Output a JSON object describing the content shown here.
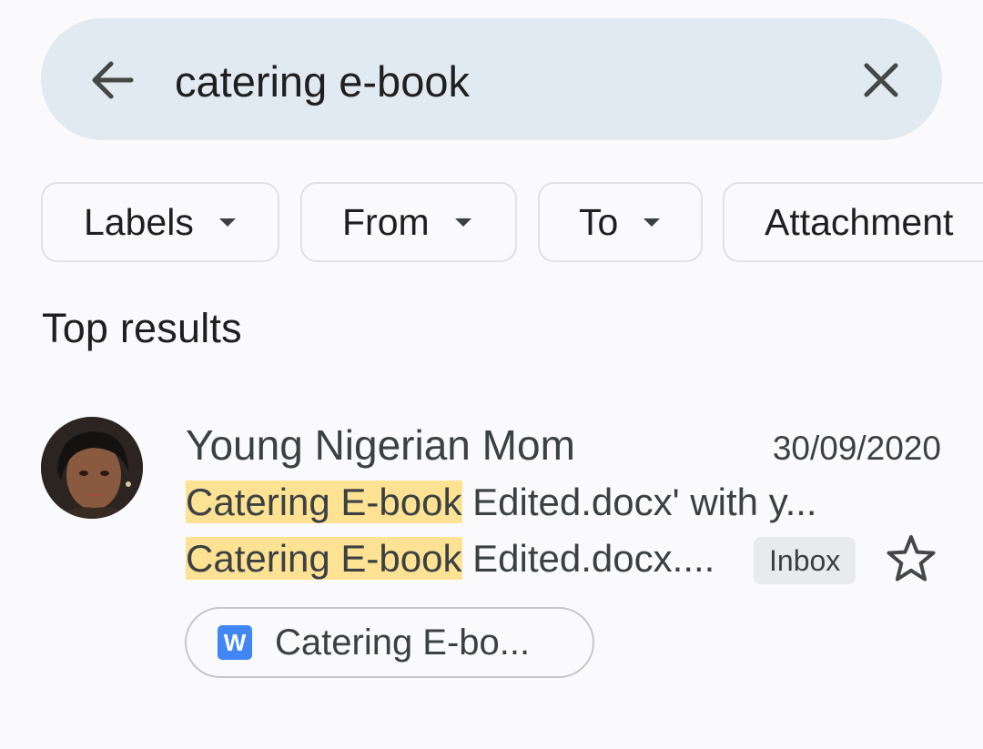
{
  "search": {
    "query": "catering e-book",
    "back_icon": "arrow-back-icon",
    "clear_icon": "close-icon",
    "bar_color": "#e1eaf0"
  },
  "filters": [
    {
      "label": "Labels",
      "icon": "caret-down-icon"
    },
    {
      "label": "From",
      "icon": "caret-down-icon"
    },
    {
      "label": "To",
      "icon": "caret-down-icon"
    },
    {
      "label": "Attachment"
    }
  ],
  "section_title": "Top results",
  "results": [
    {
      "sender": "Young Nigerian Mom",
      "date": "30/09/2020",
      "subject_highlight": "Catering E-book",
      "subject_rest": " Edited.docx' with y...",
      "snippet_highlight": "Catering E-book",
      "snippet_rest": " Edited.docx....",
      "label_badge": "Inbox",
      "starred": false,
      "attachment": {
        "icon_letter": "W",
        "icon_name": "word-doc-icon",
        "name": "Catering E-bo..."
      }
    }
  ],
  "colors": {
    "highlight": "#fde293",
    "word_blue": "#4285f4",
    "background": "#fafafd"
  }
}
